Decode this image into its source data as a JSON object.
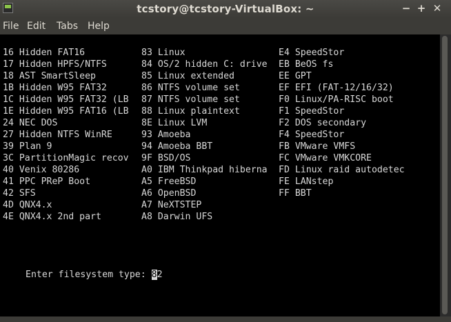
{
  "window": {
    "title": "tcstory@tcstory-VirtualBox: ~",
    "controls": {
      "minimize": "−",
      "maximize": "+",
      "close": "✕"
    }
  },
  "menu": {
    "file": "File",
    "edit": "Edit",
    "tabs": "Tabs",
    "help": "Help"
  },
  "terminal": {
    "col1": [
      "16 Hidden FAT16",
      "17 Hidden HPFS/NTFS",
      "18 AST SmartSleep",
      "1B Hidden W95 FAT32",
      "1C Hidden W95 FAT32 (LB",
      "1E Hidden W95 FAT16 (LB",
      "24 NEC DOS",
      "27 Hidden NTFS WinRE",
      "39 Plan 9",
      "3C PartitionMagic recov",
      "40 Venix 80286",
      "41 PPC PReP Boot",
      "42 SFS",
      "4D QNX4.x",
      "4E QNX4.x 2nd part"
    ],
    "col2": [
      "83 Linux",
      "84 OS/2 hidden C: drive",
      "85 Linux extended",
      "86 NTFS volume set",
      "87 NTFS volume set",
      "88 Linux plaintext",
      "8E Linux LVM",
      "93 Amoeba",
      "94 Amoeba BBT",
      "9F BSD/OS",
      "A0 IBM Thinkpad hiberna",
      "A5 FreeBSD",
      "A6 OpenBSD",
      "A7 NeXTSTEP",
      "A8 Darwin UFS"
    ],
    "col3": [
      "E4 SpeedStor",
      "EB BeOS fs",
      "EE GPT",
      "EF EFI (FAT-12/16/32)",
      "F0 Linux/PA-RISC boot",
      "F1 SpeedStor",
      "F2 DOS secondary",
      "F4 SpeedStor",
      "FB VMware VMFS",
      "FC VMware VMKCORE",
      "FD Linux raid autodetec",
      "FE LANstep",
      "FF BBT"
    ],
    "prompt": "Enter filesystem type: ",
    "input_cursor_char": "8",
    "input_rest": "2"
  },
  "colors": {
    "terminal_bg": "#000000",
    "terminal_fg": "#d8d8d8",
    "chrome_bg": "#3c3b37",
    "chrome_fg": "#dfdbd2"
  }
}
